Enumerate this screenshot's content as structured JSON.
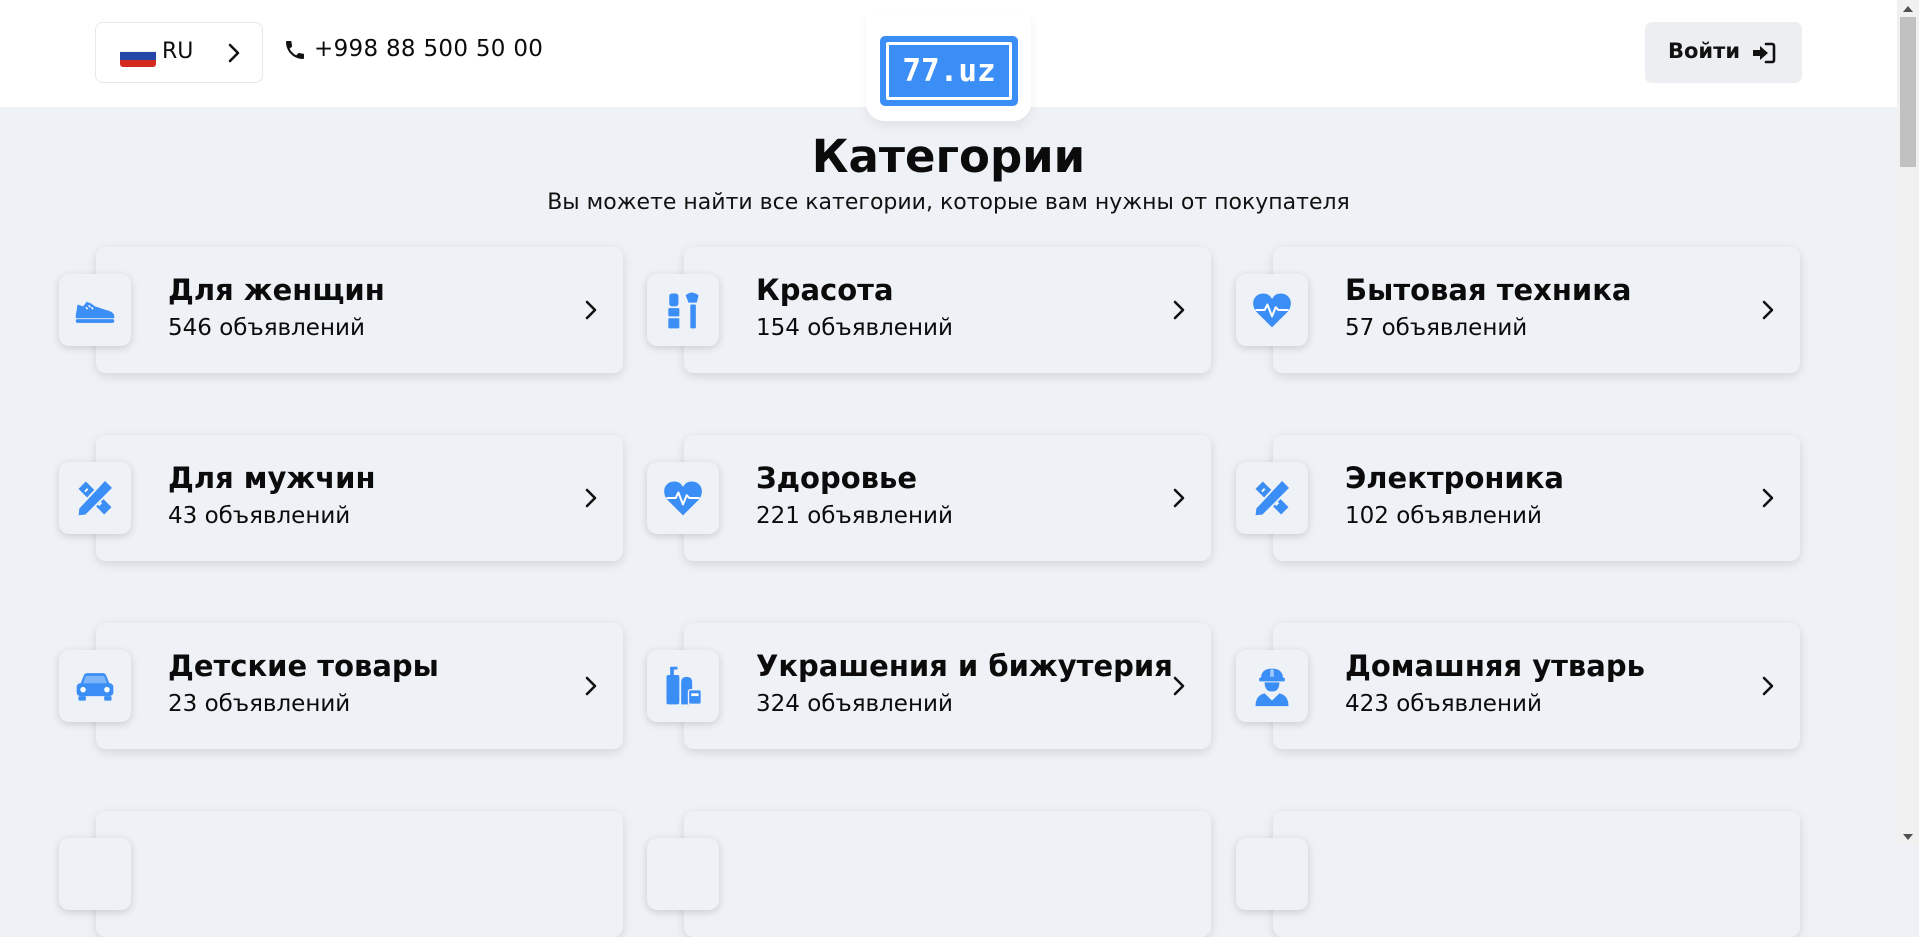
{
  "header": {
    "language": "RU",
    "phone": "+998 88 500 50 00",
    "logo_text": "77.uz",
    "login_label": "Войти"
  },
  "page": {
    "title": "Категории",
    "subtitle": "Вы можете найти все категории, которые вам нужны от покупателя"
  },
  "colors": {
    "accent": "#3a8ef6",
    "background": "#eef1f6"
  },
  "categories": [
    {
      "name": "Для женщин",
      "count": "546 объявлений",
      "icon": "sneaker-icon"
    },
    {
      "name": "Красота",
      "count": "154 объявлений",
      "icon": "makeup-icon"
    },
    {
      "name": "Бытовая техника",
      "count": "57 объявлений",
      "icon": "heart-pulse-icon"
    },
    {
      "name": "Для мужчин",
      "count": "43 объявлений",
      "icon": "ruler-pencil-icon"
    },
    {
      "name": "Здоровье",
      "count": "221 объявлений",
      "icon": "heart-pulse-icon"
    },
    {
      "name": "Электроника",
      "count": "102 объявлений",
      "icon": "ruler-pencil-icon"
    },
    {
      "name": "Детские товары",
      "count": "23 объявлений",
      "icon": "car-icon"
    },
    {
      "name": "Украшения и бижутерия",
      "count": "324 объявлений",
      "icon": "bottles-icon"
    },
    {
      "name": "Домашняя утварь",
      "count": "423 объявлений",
      "icon": "worker-icon"
    }
  ]
}
